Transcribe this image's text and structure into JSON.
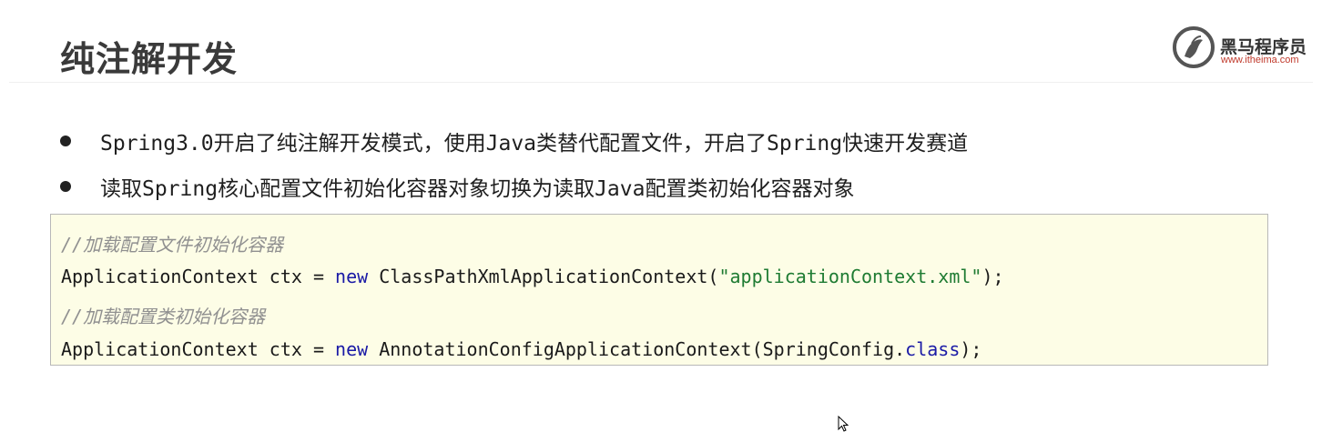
{
  "slide": {
    "title": "纯注解开发",
    "logo": {
      "name_cn": "黑马程序员",
      "url": "www.itheima.com"
    },
    "bullets": [
      "Spring3.0开启了纯注解开发模式，使用Java类替代配置文件，开启了Spring快速开发赛道",
      "读取Spring核心配置文件初始化容器对象切换为读取Java配置类初始化容器对象"
    ],
    "code": {
      "comment1": "//加载配置文件初始化容器",
      "line1_a": "ApplicationContext ctx = ",
      "line1_kw": "new",
      "line1_b": " ClassPathXmlApplicationContext(",
      "line1_str": "\"applicationContext.xml\"",
      "line1_c": ");",
      "comment2": "//加载配置类初始化容器",
      "line2_a": "ApplicationContext ctx = ",
      "line2_kw": "new",
      "line2_b": " AnnotationConfigApplicationContext(SpringConfig.",
      "line2_kw2": "class",
      "line2_c": ");"
    }
  },
  "colors": {
    "code_background": "#fdfde6",
    "keyword": "#1a1aa6",
    "string": "#1e7b32",
    "comment": "#909090"
  }
}
